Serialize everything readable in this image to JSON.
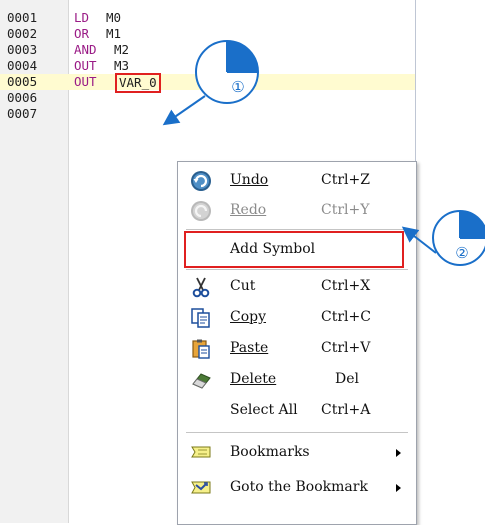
{
  "editor": {
    "lines": [
      {
        "num": "0001",
        "op": "LD",
        "arg": "M0"
      },
      {
        "num": "0002",
        "op": "OR",
        "arg": "M1"
      },
      {
        "num": "0003",
        "op": "AND",
        "arg": "M2"
      },
      {
        "num": "0004",
        "op": "OUT",
        "arg": "M3"
      },
      {
        "num": "0005",
        "op": "OUT",
        "arg": "VAR_0"
      },
      {
        "num": "0006",
        "op": "",
        "arg": ""
      },
      {
        "num": "0007",
        "op": "",
        "arg": ""
      }
    ]
  },
  "context_menu": {
    "undo": {
      "label": "Undo",
      "shortcut": "Ctrl+Z",
      "icon": "undo-icon"
    },
    "redo": {
      "label": "Redo",
      "shortcut": "Ctrl+Y",
      "icon": "redo-icon"
    },
    "add_symbol": {
      "label": "Add Symbol"
    },
    "cut": {
      "label": "Cut",
      "shortcut": "Ctrl+X",
      "icon": "scissors-icon"
    },
    "copy": {
      "label": "Copy",
      "shortcut": "Ctrl+C",
      "icon": "copy-icon"
    },
    "paste": {
      "label": "Paste",
      "shortcut": "Ctrl+V",
      "icon": "paste-icon"
    },
    "delete": {
      "label": "Delete",
      "shortcut": "Del",
      "icon": "eraser-icon"
    },
    "select_all": {
      "label": "Select All",
      "shortcut": "Ctrl+A"
    },
    "bookmarks": {
      "label": "Bookmarks",
      "icon": "bookmark-icon"
    },
    "goto_bookmark": {
      "label": "Goto the Bookmark",
      "icon": "goto-bookmark-icon"
    }
  },
  "annotations": {
    "step1": "①",
    "step2": "②"
  },
  "colors": {
    "highlight_red": "#e02020",
    "step_blue": "#1a6fc9",
    "keyword_purple": "#9a1b86",
    "current_line": "#fffbd0"
  }
}
